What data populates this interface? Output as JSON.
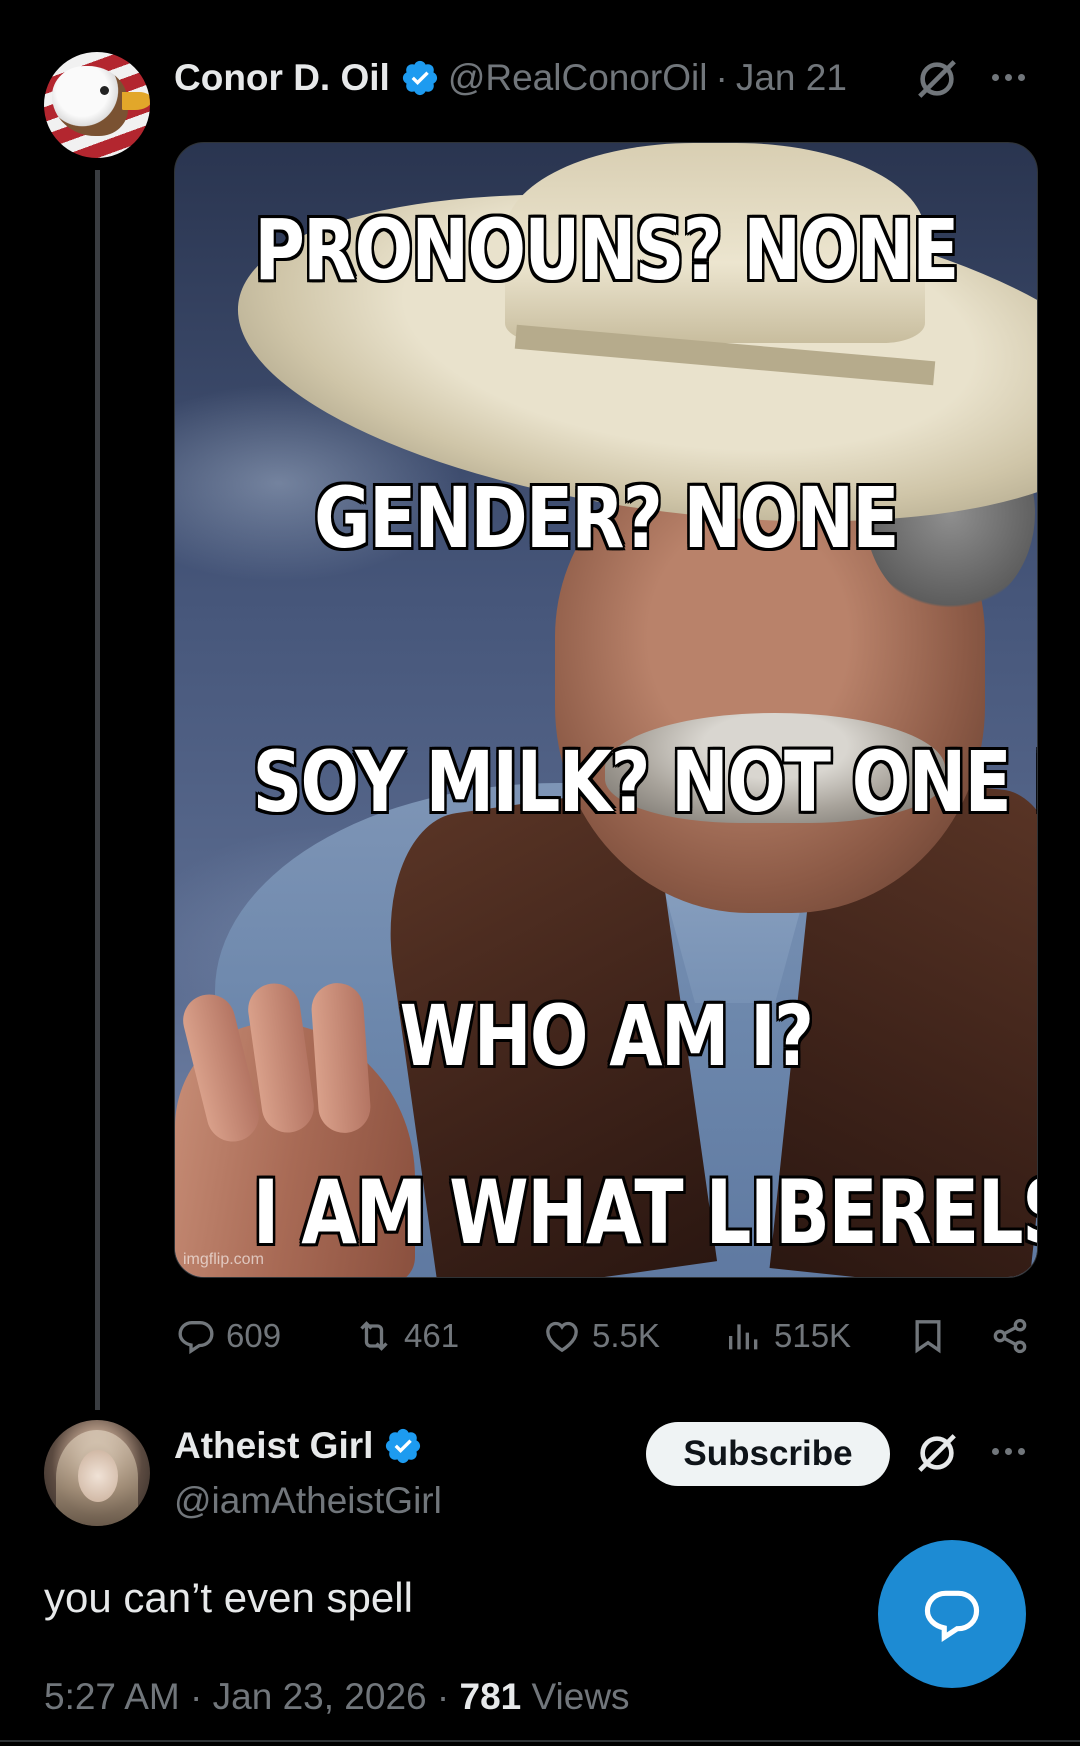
{
  "post": {
    "author_name": "Conor D. Oil",
    "author_handle": "@RealConorOil",
    "separator": "·",
    "date": "Jan 21",
    "meme": {
      "lines": [
        "PRONOUNS? NONE",
        "GENDER? NONE",
        "SOY MILK? NOT ONE DROP",
        "WHO AM I?",
        "I AM WHAT LIBERELS FEAR"
      ],
      "watermark": "imgflip.com"
    },
    "stats": {
      "replies": "609",
      "reposts": "461",
      "likes": "5.5K",
      "views": "515K"
    },
    "icons": [
      "reply-icon",
      "repost-icon",
      "like-icon",
      "views-icon",
      "bookmark-icon",
      "share-icon",
      "grok-icon",
      "more-icon",
      "verified-badge-icon"
    ]
  },
  "reply": {
    "author_name": "Atheist Girl",
    "author_handle": "@iamAtheistGirl",
    "subscribe_label": "Subscribe",
    "text": "you can’t even spell",
    "time": "5:27 AM",
    "separator": "·",
    "date": "Jan 23, 2026",
    "views_count": "781",
    "views_label": "Views"
  },
  "colors": {
    "background": "#000000",
    "verified": "#1d9bf0",
    "muted": "#71767b",
    "fab": "#1d8bd3"
  }
}
